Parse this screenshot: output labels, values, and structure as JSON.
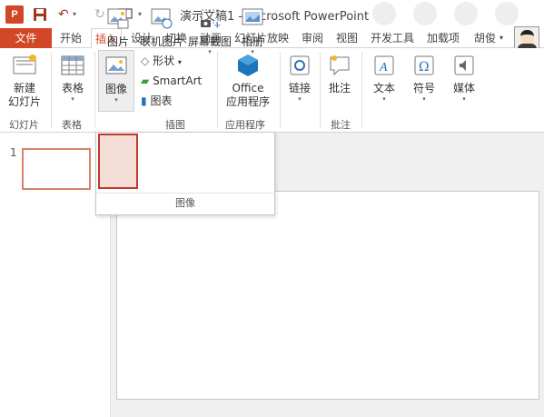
{
  "title": "演示文稿1 - Microsoft PowerPoint",
  "qat": {
    "app_icon": "P"
  },
  "tabs": {
    "file": "文件",
    "items": [
      "开始",
      "插入",
      "设计",
      "切换",
      "动画",
      "幻灯片放映",
      "审阅",
      "视图",
      "开发工具",
      "加载项"
    ],
    "active": "插入",
    "user": "胡俊"
  },
  "ribbon": {
    "new_slide": [
      "新建",
      "幻灯片"
    ],
    "table": "表格",
    "image": "图像",
    "shapes": "形状",
    "smartart": "SmartArt",
    "chart": "图表",
    "office_apps": [
      "Office",
      "应用程序"
    ],
    "link": "链接",
    "comment": "批注",
    "text": "文本",
    "symbol": "符号",
    "media": "媒体",
    "groups": {
      "slides": "幻灯片",
      "tables": "表格",
      "illustrations": "插图",
      "apps": "应用程序",
      "comments": "批注"
    }
  },
  "dropdown": {
    "items": [
      "图片",
      "联机图片",
      "屏幕截图",
      "相册"
    ],
    "group": "图像"
  },
  "slide_panel": {
    "number": "1"
  },
  "colors": {
    "accent": "#d24726",
    "highlight": "#c0392b"
  }
}
